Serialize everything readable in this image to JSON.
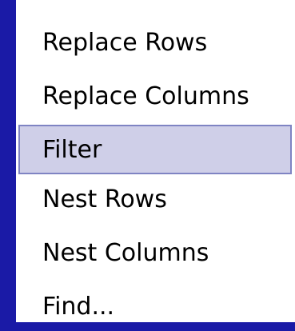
{
  "menu": {
    "items": [
      {
        "label": "Replace Rows"
      },
      {
        "label": "Replace Columns"
      },
      {
        "label": "Filter"
      },
      {
        "label": "Nest Rows"
      },
      {
        "label": "Nest Columns"
      },
      {
        "label": "Find..."
      }
    ],
    "highlighted_item": "Filter"
  },
  "colors": {
    "background": "#1a1aa6",
    "menu_background": "#ffffff",
    "highlight_fill": "#cfcfe8",
    "highlight_border": "#7f84c3"
  }
}
